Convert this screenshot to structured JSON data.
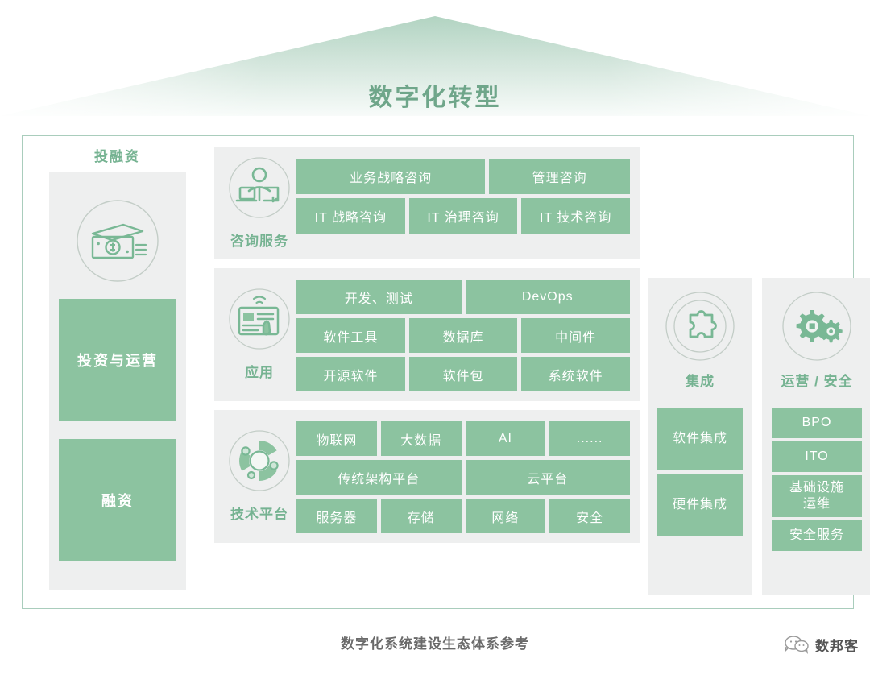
{
  "roof": {
    "title": "数字化转型"
  },
  "finance_column": {
    "header": "投融资",
    "icon": "money-cash-icon",
    "tiles": [
      {
        "label": "投资与运营"
      },
      {
        "label": "融资"
      }
    ]
  },
  "middle_panels": [
    {
      "key": "consulting",
      "icon": "person-laptop-consulting-icon",
      "label": "咨询服务",
      "rows": [
        [
          {
            "label": "业务战略咨询",
            "flex": 1.34
          },
          {
            "label": "管理咨询",
            "flex": 1
          }
        ],
        [
          {
            "label": "IT 战略咨询",
            "flex": 1
          },
          {
            "label": "IT 治理咨询",
            "flex": 1
          },
          {
            "label": "IT 技术咨询",
            "flex": 1
          }
        ]
      ]
    },
    {
      "key": "application",
      "icon": "tablet-touch-app-icon",
      "label": "应用",
      "rows": [
        [
          {
            "label": "开发、测试",
            "flex": 1
          },
          {
            "label": "DevOps",
            "flex": 1
          }
        ],
        [
          {
            "label": "软件工具",
            "flex": 1
          },
          {
            "label": "数据库",
            "flex": 1
          },
          {
            "label": "中间件",
            "flex": 1
          }
        ],
        [
          {
            "label": "开源软件",
            "flex": 1
          },
          {
            "label": "软件包",
            "flex": 1
          },
          {
            "label": "系统软件",
            "flex": 1
          }
        ]
      ]
    },
    {
      "key": "technology_platform",
      "icon": "gear-donut-platform-icon",
      "label": "技术平台",
      "rows": [
        [
          {
            "label": "物联网",
            "flex": 1
          },
          {
            "label": "大数据",
            "flex": 1
          },
          {
            "label": "AI",
            "flex": 1
          },
          {
            "label": "......",
            "flex": 1
          }
        ],
        [
          {
            "label": "传统架构平台",
            "flex": 1
          },
          {
            "label": "云平台",
            "flex": 1
          }
        ],
        [
          {
            "label": "服务器",
            "flex": 1
          },
          {
            "label": "存储",
            "flex": 1
          },
          {
            "label": "网络",
            "flex": 1
          },
          {
            "label": "安全",
            "flex": 1
          }
        ]
      ]
    }
  ],
  "integration_column": {
    "icon": "puzzle-piece-integration-icon",
    "label": "集成",
    "tiles": [
      {
        "label": "软件集成"
      },
      {
        "label": "硬件集成"
      }
    ]
  },
  "operations_column": {
    "icon": "gears-operations-security-icon",
    "label": "运营 / 安全",
    "tiles": [
      {
        "label": "BPO",
        "tall": false
      },
      {
        "label": "ITO",
        "tall": false
      },
      {
        "label": "基础设施\n运维",
        "tall": true
      },
      {
        "label": "安全服务",
        "tall": false
      }
    ]
  },
  "footer": {
    "caption": "数字化系统建设生态体系参考",
    "brand_name": "数邦客",
    "brand_icon": "wechat-speech-bubbles-icon"
  },
  "colors": {
    "tile_green": "#8cc3a0",
    "panel_gray": "#eeefef",
    "accent_text": "#76b392",
    "frame_border": "#a9cdbc",
    "roof_green": "#bcd9c9",
    "title_green": "#6fa68a"
  }
}
